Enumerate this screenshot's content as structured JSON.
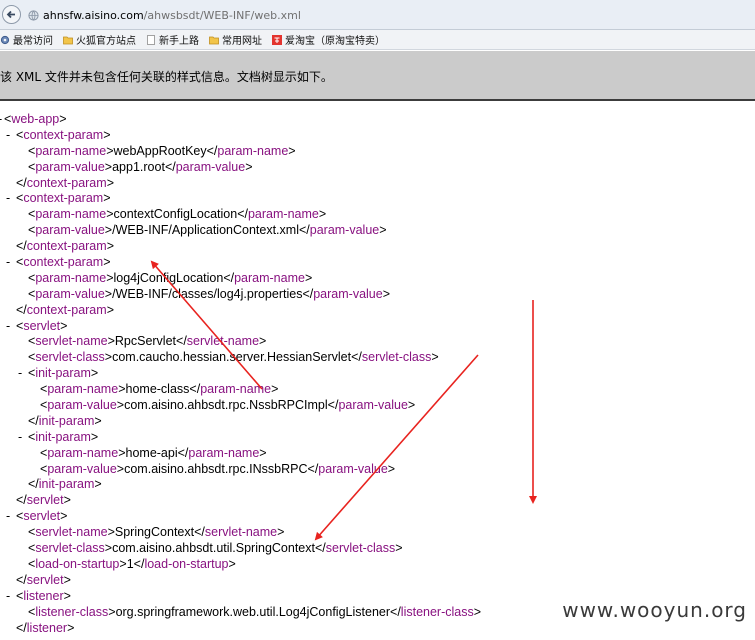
{
  "browser": {
    "url_host": "ahnsfw.aisino.com",
    "url_path": "/ahwsbsdt/WEB-INF/web.xml",
    "bookmarks": [
      {
        "label": "最常访问",
        "icon": "gear-icon"
      },
      {
        "label": "火狐官方站点",
        "icon": "folder-icon"
      },
      {
        "label": "新手上路",
        "icon": "page-icon"
      },
      {
        "label": "常用网址",
        "icon": "folder-icon"
      },
      {
        "label": "爱淘宝（原淘宝特卖）",
        "icon": "taobao-icon"
      }
    ]
  },
  "notice": "该 XML 文件并未包含任何关联的样式信息。文档树显示如下。",
  "xml_lines": [
    {
      "indent": 0,
      "toggle": "-",
      "open": "web-app"
    },
    {
      "indent": 1,
      "toggle": "-",
      "open": "context-param"
    },
    {
      "indent": 2,
      "tag": "param-name",
      "value": "webAppRootKey"
    },
    {
      "indent": 2,
      "tag": "param-value",
      "value": "app1.root"
    },
    {
      "indent": 1,
      "close": "context-param"
    },
    {
      "indent": 1,
      "toggle": "-",
      "open": "context-param"
    },
    {
      "indent": 2,
      "tag": "param-name",
      "value": "contextConfigLocation"
    },
    {
      "indent": 2,
      "tag": "param-value",
      "value": "/WEB-INF/ApplicationContext.xml"
    },
    {
      "indent": 1,
      "close": "context-param"
    },
    {
      "indent": 1,
      "toggle": "-",
      "open": "context-param"
    },
    {
      "indent": 2,
      "tag": "param-name",
      "value": "log4jConfigLocation"
    },
    {
      "indent": 2,
      "tag": "param-value",
      "value": "/WEB-INF/classes/log4j.properties"
    },
    {
      "indent": 1,
      "close": "context-param"
    },
    {
      "indent": 1,
      "toggle": "-",
      "open": "servlet"
    },
    {
      "indent": 2,
      "tag": "servlet-name",
      "value": "RpcServlet"
    },
    {
      "indent": 2,
      "tag": "servlet-class",
      "value": "com.caucho.hessian.server.HessianServlet"
    },
    {
      "indent": 2,
      "toggle": "-",
      "open": "init-param"
    },
    {
      "indent": 3,
      "tag": "param-name",
      "value": "home-class"
    },
    {
      "indent": 3,
      "tag": "param-value",
      "value": "com.aisino.ahbsdt.rpc.NssbRPCImpl"
    },
    {
      "indent": 2,
      "close": "init-param"
    },
    {
      "indent": 2,
      "toggle": "-",
      "open": "init-param"
    },
    {
      "indent": 3,
      "tag": "param-name",
      "value": "home-api"
    },
    {
      "indent": 3,
      "tag": "param-value",
      "value": "com.aisino.ahbsdt.rpc.INssbRPC"
    },
    {
      "indent": 2,
      "close": "init-param"
    },
    {
      "indent": 1,
      "close": "servlet"
    },
    {
      "indent": 1,
      "toggle": "-",
      "open": "servlet"
    },
    {
      "indent": 2,
      "tag": "servlet-name",
      "value": "SpringContext"
    },
    {
      "indent": 2,
      "tag": "servlet-class",
      "value": "com.aisino.ahbsdt.util.SpringContext"
    },
    {
      "indent": 2,
      "tag": "load-on-startup",
      "value": "1"
    },
    {
      "indent": 1,
      "close": "servlet"
    },
    {
      "indent": 1,
      "toggle": "-",
      "open": "listener"
    },
    {
      "indent": 2,
      "tag": "listener-class",
      "value": "org.springframework.web.util.Log4jConfigListener"
    },
    {
      "indent": 1,
      "close": "listener"
    }
  ],
  "watermark": "www.wooyun.org",
  "colors": {
    "tag": "#881280",
    "arrow": "#e8231f",
    "notice_bg": "#cbcbcb"
  }
}
